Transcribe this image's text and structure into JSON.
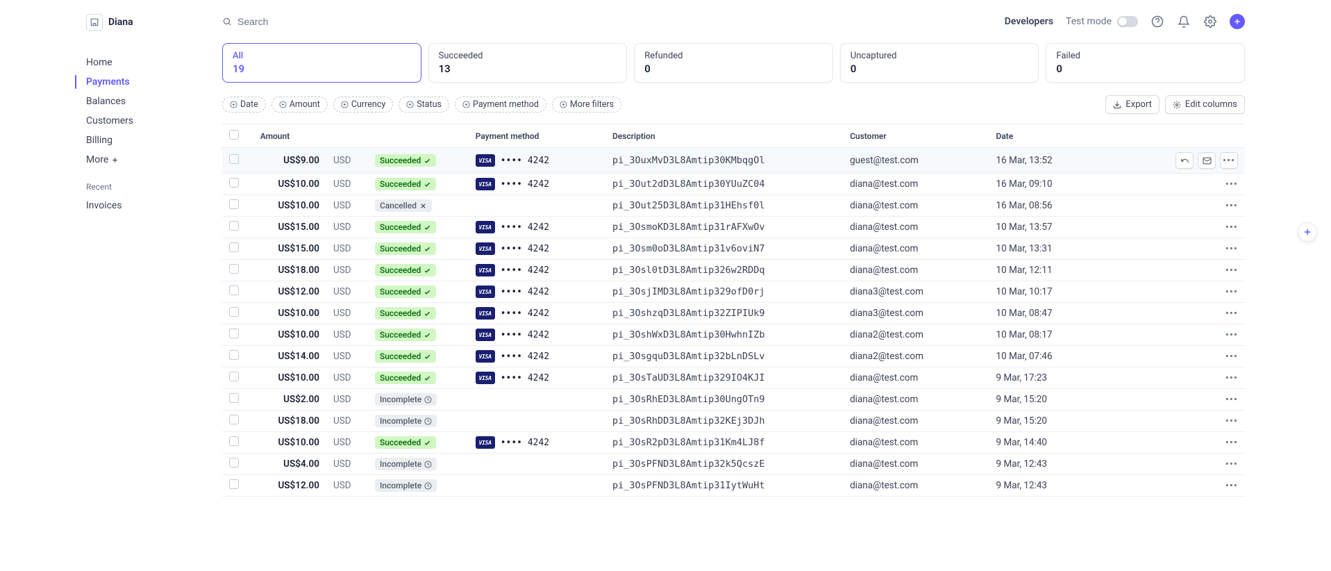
{
  "brand": {
    "name": "Diana"
  },
  "nav": {
    "items": [
      {
        "label": "Home"
      },
      {
        "label": "Payments",
        "active": true
      },
      {
        "label": "Balances"
      },
      {
        "label": "Customers"
      },
      {
        "label": "Billing"
      },
      {
        "label": "More"
      }
    ],
    "recent_label": "Recent",
    "recent_items": [
      {
        "label": "Invoices"
      }
    ]
  },
  "topbar": {
    "search_placeholder": "Search",
    "developers": "Developers",
    "test_mode": "Test mode"
  },
  "stats": {
    "cards": [
      {
        "label": "All",
        "value": "19",
        "active": true
      },
      {
        "label": "Succeeded",
        "value": "13"
      },
      {
        "label": "Refunded",
        "value": "0"
      },
      {
        "label": "Uncaptured",
        "value": "0"
      },
      {
        "label": "Failed",
        "value": "0"
      }
    ]
  },
  "filters": {
    "pills": [
      {
        "label": "Date"
      },
      {
        "label": "Amount"
      },
      {
        "label": "Currency"
      },
      {
        "label": "Status"
      },
      {
        "label": "Payment method"
      },
      {
        "label": "More filters"
      }
    ],
    "export": "Export",
    "edit_columns": "Edit columns"
  },
  "table": {
    "headers": {
      "amount": "Amount",
      "payment_method": "Payment method",
      "description": "Description",
      "customer": "Customer",
      "date": "Date"
    },
    "status_labels": {
      "succeeded": "Succeeded",
      "cancelled": "Cancelled",
      "incomplete": "Incomplete"
    },
    "card_brand": "VISA",
    "rows": [
      {
        "amount": "US$9.00",
        "currency": "USD",
        "status": "succeeded",
        "pm_last4": "•••• 4242",
        "has_pm": true,
        "description": "pi_3OuxMvD3L8Amtip30KMbqgOl",
        "customer": "guest@test.com",
        "date": "16 Mar, 13:52",
        "hovered": true
      },
      {
        "amount": "US$10.00",
        "currency": "USD",
        "status": "succeeded",
        "pm_last4": "•••• 4242",
        "has_pm": true,
        "description": "pi_3Out2dD3L8Amtip30YUuZC04",
        "customer": "diana@test.com",
        "date": "16 Mar, 09:10"
      },
      {
        "amount": "US$10.00",
        "currency": "USD",
        "status": "cancelled",
        "has_pm": false,
        "description": "pi_3Out25D3L8Amtip31HEhsf0l",
        "customer": "diana@test.com",
        "date": "16 Mar, 08:56"
      },
      {
        "amount": "US$15.00",
        "currency": "USD",
        "status": "succeeded",
        "pm_last4": "•••• 4242",
        "has_pm": true,
        "description": "pi_3OsmoKD3L8Amtip31rAFXwOv",
        "customer": "diana@test.com",
        "date": "10 Mar, 13:57"
      },
      {
        "amount": "US$15.00",
        "currency": "USD",
        "status": "succeeded",
        "pm_last4": "•••• 4242",
        "has_pm": true,
        "description": "pi_3Osm0oD3L8Amtip31v6oviN7",
        "customer": "diana@test.com",
        "date": "10 Mar, 13:31"
      },
      {
        "amount": "US$18.00",
        "currency": "USD",
        "status": "succeeded",
        "pm_last4": "•••• 4242",
        "has_pm": true,
        "description": "pi_3Osl0tD3L8Amtip326w2RDDq",
        "customer": "diana@test.com",
        "date": "10 Mar, 12:11"
      },
      {
        "amount": "US$12.00",
        "currency": "USD",
        "status": "succeeded",
        "pm_last4": "•••• 4242",
        "has_pm": true,
        "description": "pi_3OsjIMD3L8Amtip329ofD0rj",
        "customer": "diana3@test.com",
        "date": "10 Mar, 10:17"
      },
      {
        "amount": "US$10.00",
        "currency": "USD",
        "status": "succeeded",
        "pm_last4": "•••• 4242",
        "has_pm": true,
        "description": "pi_3OshzqD3L8Amtip32ZIPIUk9",
        "customer": "diana3@test.com",
        "date": "10 Mar, 08:47"
      },
      {
        "amount": "US$10.00",
        "currency": "USD",
        "status": "succeeded",
        "pm_last4": "•••• 4242",
        "has_pm": true,
        "description": "pi_3OshWxD3L8Amtip30HwhnIZb",
        "customer": "diana2@test.com",
        "date": "10 Mar, 08:17"
      },
      {
        "amount": "US$14.00",
        "currency": "USD",
        "status": "succeeded",
        "pm_last4": "•••• 4242",
        "has_pm": true,
        "description": "pi_3OsgquD3L8Amtip32bLnDSLv",
        "customer": "diana2@test.com",
        "date": "10 Mar, 07:46"
      },
      {
        "amount": "US$10.00",
        "currency": "USD",
        "status": "succeeded",
        "pm_last4": "•••• 4242",
        "has_pm": true,
        "description": "pi_3OsTaUD3L8Amtip329IO4KJI",
        "customer": "diana@test.com",
        "date": "9 Mar, 17:23"
      },
      {
        "amount": "US$2.00",
        "currency": "USD",
        "status": "incomplete",
        "has_pm": false,
        "description": "pi_3OsRhED3L8Amtip30UngOTn9",
        "customer": "diana@test.com",
        "date": "9 Mar, 15:20"
      },
      {
        "amount": "US$18.00",
        "currency": "USD",
        "status": "incomplete",
        "has_pm": false,
        "description": "pi_3OsRhDD3L8Amtip32KEj3DJh",
        "customer": "diana@test.com",
        "date": "9 Mar, 15:20"
      },
      {
        "amount": "US$10.00",
        "currency": "USD",
        "status": "succeeded",
        "pm_last4": "•••• 4242",
        "has_pm": true,
        "description": "pi_3OsR2pD3L8Amtip31Km4LJ8f",
        "customer": "diana@test.com",
        "date": "9 Mar, 14:40"
      },
      {
        "amount": "US$4.00",
        "currency": "USD",
        "status": "incomplete",
        "has_pm": false,
        "description": "pi_3OsPFND3L8Amtip32k5QcszE",
        "customer": "diana@test.com",
        "date": "9 Mar, 12:43"
      },
      {
        "amount": "US$12.00",
        "currency": "USD",
        "status": "incomplete",
        "has_pm": false,
        "description": "pi_3OsPFND3L8Amtip31IytWuHt",
        "customer": "diana@test.com",
        "date": "9 Mar, 12:43"
      }
    ]
  }
}
